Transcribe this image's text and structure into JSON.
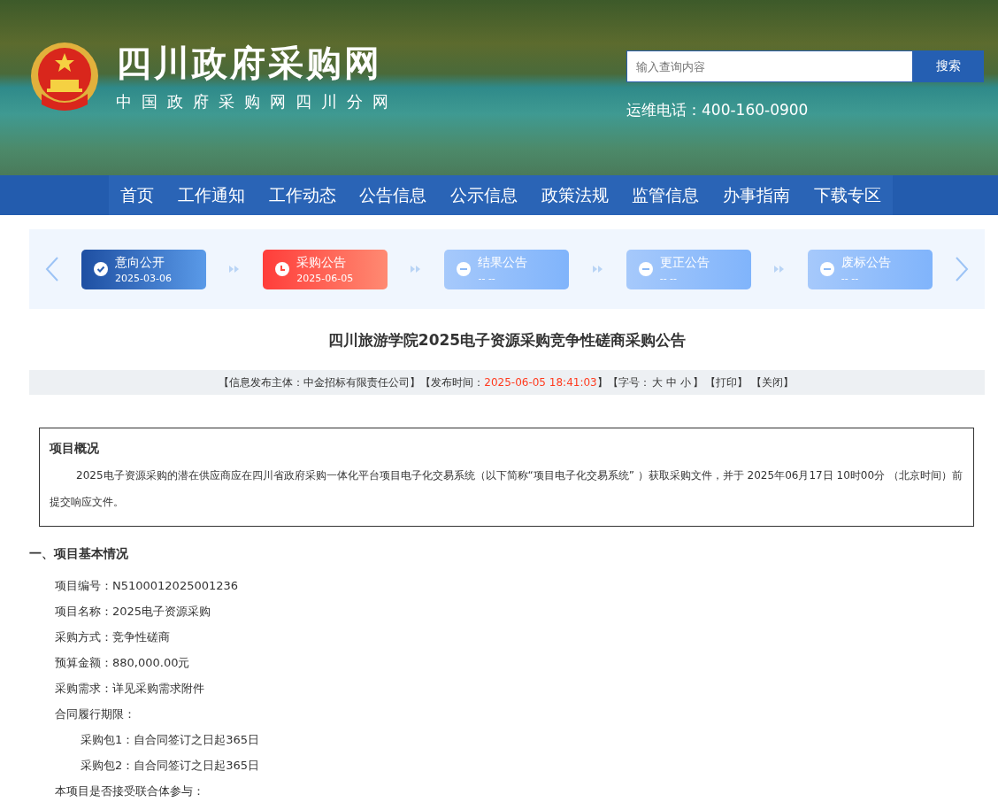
{
  "header": {
    "site_title": "四川政府采购网",
    "site_subtitle": "中国政府采购网四川分网",
    "search": {
      "placeholder": "输入查询内容",
      "button": "搜索"
    },
    "hotline": "运维电话：400-160-0900"
  },
  "nav": [
    "首页",
    "工作通知",
    "工作动态",
    "公告信息",
    "公示信息",
    "政策法规",
    "监管信息",
    "办事指南",
    "下载专区"
  ],
  "steps": [
    {
      "label": "意向公开",
      "date": "2025-03-06",
      "kind": "done"
    },
    {
      "label": "采购公告",
      "date": "2025-06-05",
      "kind": "current"
    },
    {
      "label": "结果公告",
      "date": "-- --",
      "kind": "pending"
    },
    {
      "label": "更正公告",
      "date": "-- --",
      "kind": "pending"
    },
    {
      "label": "废标公告",
      "date": "-- --",
      "kind": "pending"
    }
  ],
  "article": {
    "title": "四川旅游学院2025电子资源采购竞争性磋商采购公告",
    "meta": [
      {
        "text": "【信息发布主体：中金招标有限责任公司】",
        "kind": "plain"
      },
      {
        "text": "【发布时间：",
        "kind": "plain"
      },
      {
        "text": "2025-06-05 18:41:03",
        "kind": "highlight"
      },
      {
        "text": "】【字号：",
        "kind": "plain"
      },
      {
        "text": "大",
        "kind": "link"
      },
      {
        "text": "中",
        "kind": "link"
      },
      {
        "text": "小",
        "kind": "link"
      },
      {
        "text": "】",
        "kind": "plain"
      },
      {
        "text": "【打印】",
        "kind": "link"
      },
      {
        "text": "【关闭】",
        "kind": "link"
      }
    ],
    "overview": {
      "heading": "项目概况",
      "text": "2025电子资源采购的潜在供应商应在四川省政府采购一体化平台项目电子化交易系统（以下简称“项目电子化交易系统” ）获取采购文件，并于 2025年06月17日 10时00分 （北京时间）前提交响应文件。"
    },
    "section_heading": "一、项目基本情况",
    "lines": [
      {
        "text": "项目编号：N5100012025001236",
        "kind": "line"
      },
      {
        "text": "项目名称：2025电子资源采购",
        "kind": "line"
      },
      {
        "text": "采购方式：竞争性磋商",
        "kind": "line"
      },
      {
        "text": "预算金额：880,000.00元",
        "kind": "line"
      },
      {
        "text": "采购需求：详见采购需求附件",
        "kind": "line"
      },
      {
        "text": "合同履行期限：",
        "kind": "line"
      },
      {
        "text": "采购包1：自合同签订之日起365日",
        "kind": "sub"
      },
      {
        "text": "采购包2：自合同签订之日起365日",
        "kind": "sub"
      },
      {
        "text": "本项目是否接受联合体参与：",
        "kind": "line"
      }
    ]
  }
}
